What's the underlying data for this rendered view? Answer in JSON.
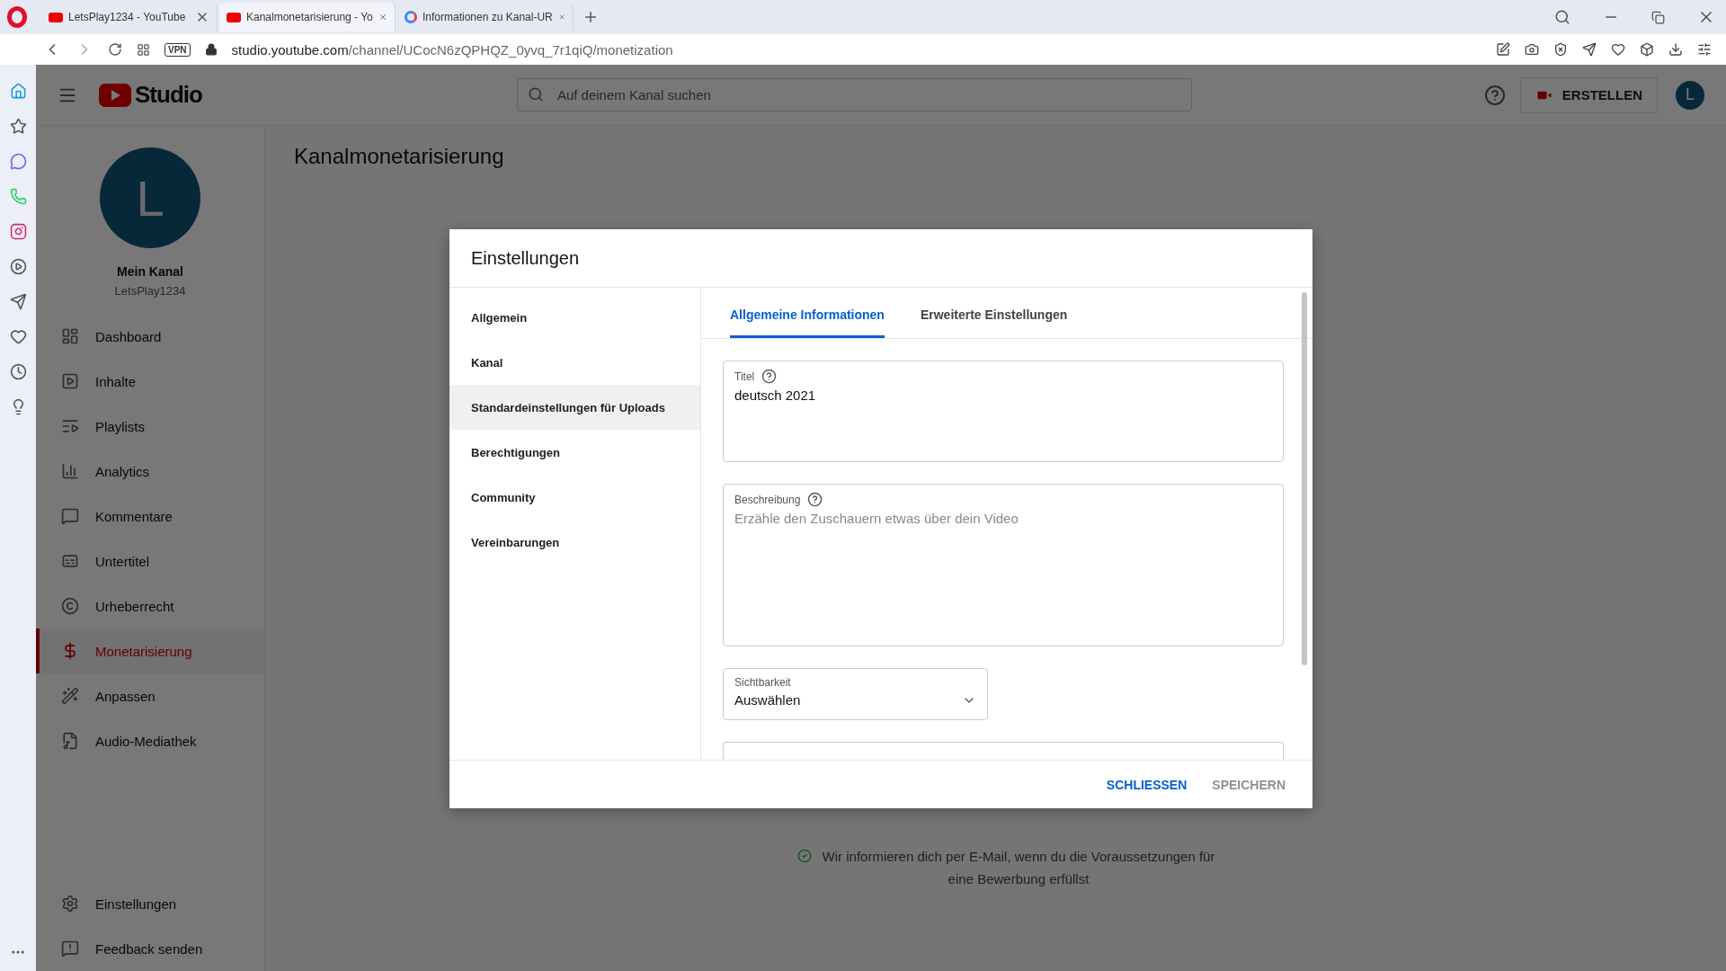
{
  "browser": {
    "tabs": [
      {
        "title": "LetsPlay1234 - YouTube",
        "kind": "youtube",
        "selected": false
      },
      {
        "title": "Kanalmonetarisierung - Yo",
        "kind": "youtube",
        "selected": true
      },
      {
        "title": "Informationen zu Kanal-UR",
        "kind": "google",
        "selected": false
      }
    ],
    "vpn": "VPN",
    "url": "**studio.youtube.com**/channel/UCocN6zQPHQZ_0yvq_7r1qiQ/monetization"
  },
  "header": {
    "logo": "Studio",
    "search_placeholder": "Auf deinem Kanal suchen",
    "create": "ERSTELLEN",
    "avatar": "L"
  },
  "channel": {
    "avatar": "L",
    "name": "Mein Kanal",
    "handle": "LetsPlay1234"
  },
  "nav": [
    {
      "label": "Dashboard",
      "selected": false
    },
    {
      "label": "Inhalte",
      "selected": false
    },
    {
      "label": "Playlists",
      "selected": false
    },
    {
      "label": "Analytics",
      "selected": false
    },
    {
      "label": "Kommentare",
      "selected": false
    },
    {
      "label": "Untertitel",
      "selected": false
    },
    {
      "label": "Urheberrecht",
      "selected": false
    },
    {
      "label": "Monetarisierung",
      "selected": true
    },
    {
      "label": "Anpassen",
      "selected": false
    },
    {
      "label": "Audio-Mediathek",
      "selected": false
    }
  ],
  "nav_bottom": [
    "Einstellungen",
    "Feedback senden"
  ],
  "page_title": "Kanalmonetarisierung",
  "notice": "Wir informieren dich per E-Mail, wenn du die Voraussetzungen für eine Bewerbung erfüllst",
  "dialog": {
    "title": "Einstellungen",
    "sections": [
      {
        "label": "Allgemein",
        "selected": false
      },
      {
        "label": "Kanal",
        "selected": false
      },
      {
        "label": "Standardeinstellungen für Uploads",
        "selected": true
      },
      {
        "label": "Berechtigungen",
        "selected": false
      },
      {
        "label": "Community",
        "selected": false
      },
      {
        "label": "Vereinbarungen",
        "selected": false
      }
    ],
    "tabs": [
      {
        "label": "Allgemeine Informationen",
        "selected": true
      },
      {
        "label": "Erweiterte Einstellungen",
        "selected": false
      }
    ],
    "title_field": {
      "label": "Titel",
      "value": "deutsch 2021"
    },
    "description_field": {
      "label": "Beschreibung",
      "placeholder": "Erzähle den Zuschauern etwas über dein Video"
    },
    "visibility_field": {
      "label": "Sichtbarkeit",
      "value": "Auswählen"
    },
    "buttons": [
      {
        "label": "SCHLIESSEN",
        "disabled": false
      },
      {
        "label": "SPEICHERN",
        "disabled": true
      }
    ]
  }
}
